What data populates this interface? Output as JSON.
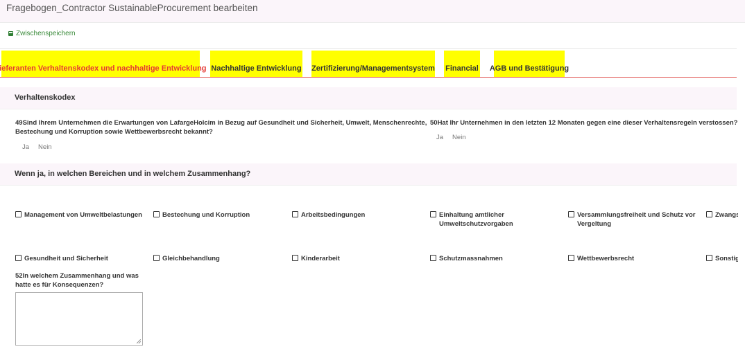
{
  "header": {
    "title": "Fragebogen_Contractor SustainableProcurement bearbeiten"
  },
  "toolbar": {
    "save_label": "Zwischenspeichern",
    "save_icon": "floppy-disk-icon"
  },
  "tabs": [
    {
      "label": "Lieferanten Verhaltenskodex und nachhaltige Entwicklung",
      "active": true
    },
    {
      "label": "Nachhaltige Entwicklung"
    },
    {
      "label": "Zertifizierung/Managementsystem"
    },
    {
      "label": "Financial"
    },
    {
      "label": "AGB und Bestätigung"
    }
  ],
  "colors": {
    "tab_bg": "#ffff00",
    "active_text": "#e53935",
    "accent_line": "#e0524f",
    "save_green": "#2e7d32"
  },
  "section1": {
    "title": "Verhaltenskodex"
  },
  "q49": {
    "line1": "49Sind Ihrem Unternehmen die Erwartungen von LafargeHolcim in Bezug auf Gesundheit und Sicherheit, Umwelt, Menschenrechte,",
    "line2": "Bestechung und Korruption sowie Wettbewerbsrecht bekannt?",
    "yes": "Ja",
    "no": "Nein"
  },
  "q50": {
    "text": "50Hat Ihr Unternehmen in den letzten 12 Monaten gegen eine dieser Verhaltensregeln verstossen?",
    "yes": "Ja",
    "no": "Nein"
  },
  "section2": {
    "title": "Wenn ja, in welchen Bereichen und in welchem Zusammenhang?"
  },
  "checkboxes": {
    "row1": [
      "Management von Umweltbelastungen",
      "Bestechung und Korruption",
      "Arbeitsbedingungen",
      "Einhaltung amtlicher Umweltschutzvorgaben",
      "Versammlungsfreiheit und Schutz vor Vergeltung",
      "Zwangs"
    ],
    "row2": [
      "Gesundheit und Sicherheit",
      "Gleichbehandlung",
      "Kinderarbeit",
      "Schutzmassnahmen",
      "Wettbewerbsrecht",
      "Sonstig"
    ]
  },
  "q52": {
    "line1": "52In welchem Zusammenhang und was",
    "line2": "hatte es für Konsequenzen?",
    "value": ""
  }
}
